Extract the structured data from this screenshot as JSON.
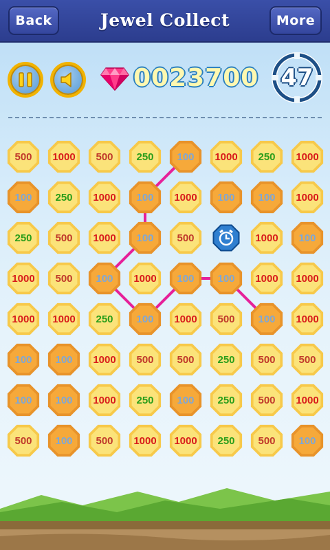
{
  "header": {
    "back_label": "Back",
    "title": "Jewel Collect",
    "more_label": "More"
  },
  "hud": {
    "score": "0023700",
    "time_left": "47"
  },
  "colors": {
    "header": "#2c3d8e",
    "tile_light": "#fbe37a",
    "tile_dark": "#f6a93a",
    "val_500": "#c0392b",
    "val_1000": "#d81b1b",
    "val_250": "#2a9d1a",
    "val_100": "#7ea7d6",
    "link": "#e6219a"
  },
  "board": {
    "rows": [
      [
        {
          "v": "500",
          "t": "light"
        },
        {
          "v": "1000",
          "t": "light"
        },
        {
          "v": "500",
          "t": "light"
        },
        {
          "v": "250",
          "t": "light"
        },
        {
          "v": "100",
          "t": "dark"
        },
        {
          "v": "1000",
          "t": "light"
        },
        {
          "v": "250",
          "t": "light"
        },
        {
          "v": "1000",
          "t": "light"
        }
      ],
      [
        {
          "v": "100",
          "t": "dark"
        },
        {
          "v": "250",
          "t": "light"
        },
        {
          "v": "1000",
          "t": "light"
        },
        {
          "v": "100",
          "t": "dark"
        },
        {
          "v": "1000",
          "t": "light"
        },
        {
          "v": "100",
          "t": "dark"
        },
        {
          "v": "100",
          "t": "dark"
        },
        {
          "v": "1000",
          "t": "light"
        }
      ],
      [
        {
          "v": "250",
          "t": "light"
        },
        {
          "v": "500",
          "t": "light"
        },
        {
          "v": "1000",
          "t": "light"
        },
        {
          "v": "100",
          "t": "dark"
        },
        {
          "v": "500",
          "t": "light"
        },
        {
          "v": "clock",
          "t": "special"
        },
        {
          "v": "1000",
          "t": "light"
        },
        {
          "v": "100",
          "t": "dark"
        }
      ],
      [
        {
          "v": "1000",
          "t": "light"
        },
        {
          "v": "500",
          "t": "light"
        },
        {
          "v": "100",
          "t": "dark"
        },
        {
          "v": "1000",
          "t": "light"
        },
        {
          "v": "100",
          "t": "dark"
        },
        {
          "v": "100",
          "t": "dark"
        },
        {
          "v": "1000",
          "t": "light"
        },
        {
          "v": "1000",
          "t": "light"
        }
      ],
      [
        {
          "v": "1000",
          "t": "light"
        },
        {
          "v": "1000",
          "t": "light"
        },
        {
          "v": "250",
          "t": "light"
        },
        {
          "v": "100",
          "t": "dark"
        },
        {
          "v": "1000",
          "t": "light"
        },
        {
          "v": "500",
          "t": "light"
        },
        {
          "v": "100",
          "t": "dark"
        },
        {
          "v": "1000",
          "t": "light"
        }
      ],
      [
        {
          "v": "100",
          "t": "dark"
        },
        {
          "v": "100",
          "t": "dark"
        },
        {
          "v": "1000",
          "t": "light"
        },
        {
          "v": "500",
          "t": "light"
        },
        {
          "v": "500",
          "t": "light"
        },
        {
          "v": "250",
          "t": "light"
        },
        {
          "v": "500",
          "t": "light"
        },
        {
          "v": "500",
          "t": "light"
        }
      ],
      [
        {
          "v": "100",
          "t": "dark"
        },
        {
          "v": "100",
          "t": "dark"
        },
        {
          "v": "1000",
          "t": "light"
        },
        {
          "v": "250",
          "t": "light"
        },
        {
          "v": "100",
          "t": "dark"
        },
        {
          "v": "250",
          "t": "light"
        },
        {
          "v": "500",
          "t": "light"
        },
        {
          "v": "1000",
          "t": "light"
        }
      ],
      [
        {
          "v": "500",
          "t": "light"
        },
        {
          "v": "100",
          "t": "dark"
        },
        {
          "v": "500",
          "t": "light"
        },
        {
          "v": "1000",
          "t": "light"
        },
        {
          "v": "1000",
          "t": "light"
        },
        {
          "v": "250",
          "t": "light"
        },
        {
          "v": "500",
          "t": "light"
        },
        {
          "v": "100",
          "t": "dark"
        }
      ]
    ],
    "link_path": [
      [
        0,
        4
      ],
      [
        1,
        3
      ],
      [
        2,
        3
      ],
      [
        3,
        2
      ],
      [
        4,
        3
      ],
      [
        3,
        4
      ],
      [
        3,
        5
      ],
      [
        4,
        6
      ]
    ]
  },
  "icons": {
    "pause": "pause-icon",
    "sound": "speaker-icon",
    "gem": "gem-icon",
    "timer": "timer-ring-icon",
    "clock_tile": "alarm-clock-icon"
  }
}
